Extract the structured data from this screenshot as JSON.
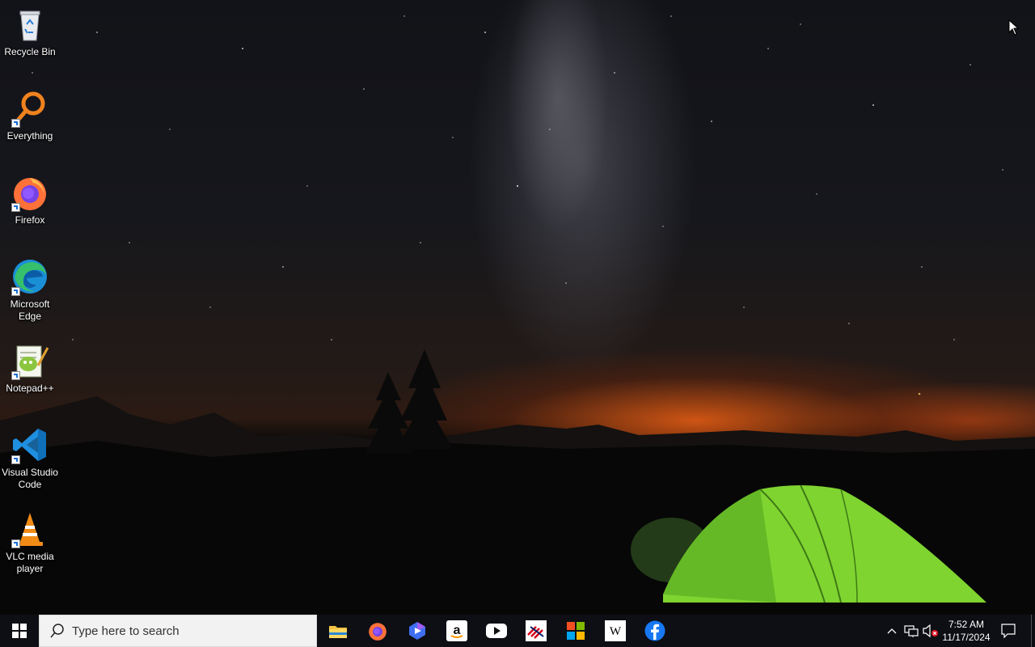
{
  "desktop": {
    "icons": [
      {
        "label": "Recycle Bin",
        "icon": "recycle-bin-icon"
      },
      {
        "label": "Everything",
        "icon": "everything-search-icon"
      },
      {
        "label": "Firefox",
        "icon": "firefox-icon"
      },
      {
        "label": "Microsoft Edge",
        "icon": "edge-icon"
      },
      {
        "label": "Notepad++",
        "icon": "notepadpp-icon"
      },
      {
        "label": "Visual Studio Code",
        "icon": "vscode-icon"
      },
      {
        "label": "VLC media player",
        "icon": "vlc-icon"
      }
    ]
  },
  "taskbar": {
    "search_placeholder": "Type here to search",
    "pinned": [
      {
        "name": "File Explorer",
        "icon": "file-explorer-icon"
      },
      {
        "name": "Firefox",
        "icon": "firefox-icon"
      },
      {
        "name": "Copilot",
        "icon": "copilot-icon"
      },
      {
        "name": "Amazon",
        "icon": "amazon-icon"
      },
      {
        "name": "YouTube",
        "icon": "youtube-icon"
      },
      {
        "name": "Bank of America",
        "icon": "bank-of-america-icon"
      },
      {
        "name": "Microsoft Store",
        "icon": "microsoft-store-icon"
      },
      {
        "name": "Wikipedia",
        "icon": "wikipedia-icon"
      },
      {
        "name": "Facebook",
        "icon": "facebook-icon"
      }
    ],
    "clock": {
      "time": "7:52 AM",
      "date": "11/17/2024"
    }
  },
  "colors": {
    "taskbar": "#0d0f14",
    "search_bg": "#f2f2f2",
    "accent_blue": "#0078d7"
  }
}
